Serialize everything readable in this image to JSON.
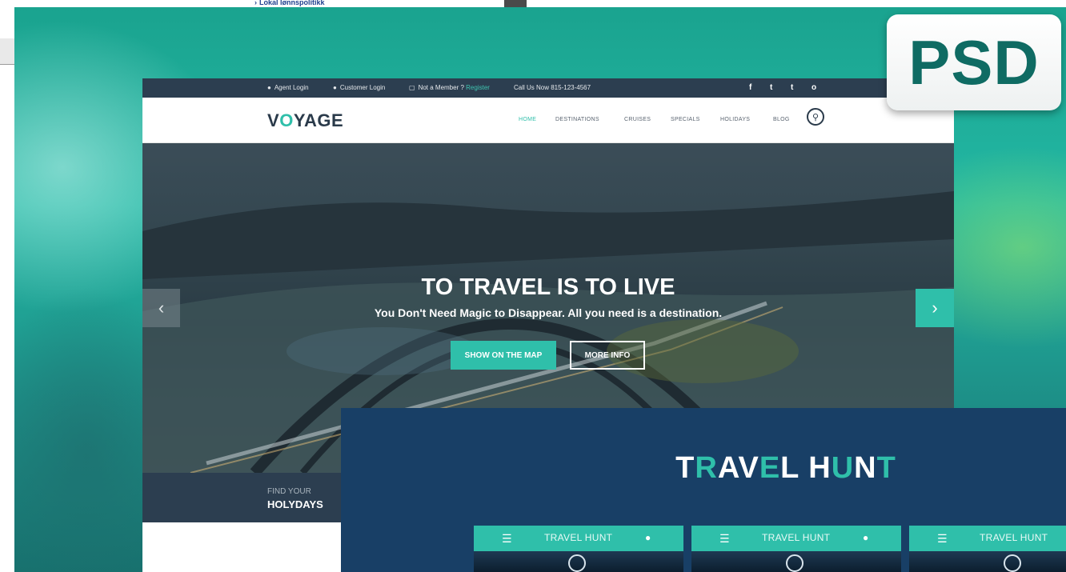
{
  "browser_fragment": {
    "link_label": "Lokal lønnspolitikk"
  },
  "badge": {
    "label": "PSD"
  },
  "utility_bar": {
    "agent_login": "Agent Login",
    "customer_login": "Customer Login",
    "not_member": "Not a Member ?",
    "register": "Register",
    "call": "Call Us Now 815-123-4567",
    "social": [
      "f",
      "t",
      "t",
      "o"
    ]
  },
  "nav": {
    "logo_v": "V",
    "logo_o": "O",
    "logo_rest": "YAGE",
    "items": [
      "HOME",
      "DESTINATIONS",
      "CRUISES",
      "SPECIALS",
      "HOLIDAYS",
      "BLOG"
    ],
    "active": "HOME"
  },
  "hero": {
    "title": "TO TRAVEL IS TO LIVE",
    "subtitle": "You Don't Need Magic to Disappear. All you need is a destination.",
    "btn_map": "SHOW ON THE MAP",
    "btn_info": "MORE INFO",
    "prev_arrow": "‹",
    "next_arrow": "›"
  },
  "find": {
    "pre": "FIND YOUR",
    "main": "HOLYDAYS"
  },
  "travel_hunt": {
    "title_parts": [
      "T",
      "R",
      "AV",
      "E",
      "L H",
      "U",
      "N",
      "T"
    ],
    "cards": [
      {
        "title": "TRAVEL HUNT"
      },
      {
        "title": "TRAVEL HUNT"
      },
      {
        "title": "TRAVEL HUNT"
      }
    ]
  },
  "colors": {
    "accent": "#2fbfaa",
    "dark_bar": "#2c3e50",
    "hunt_bg": "#183f66",
    "psd_text": "#0f6b63"
  }
}
